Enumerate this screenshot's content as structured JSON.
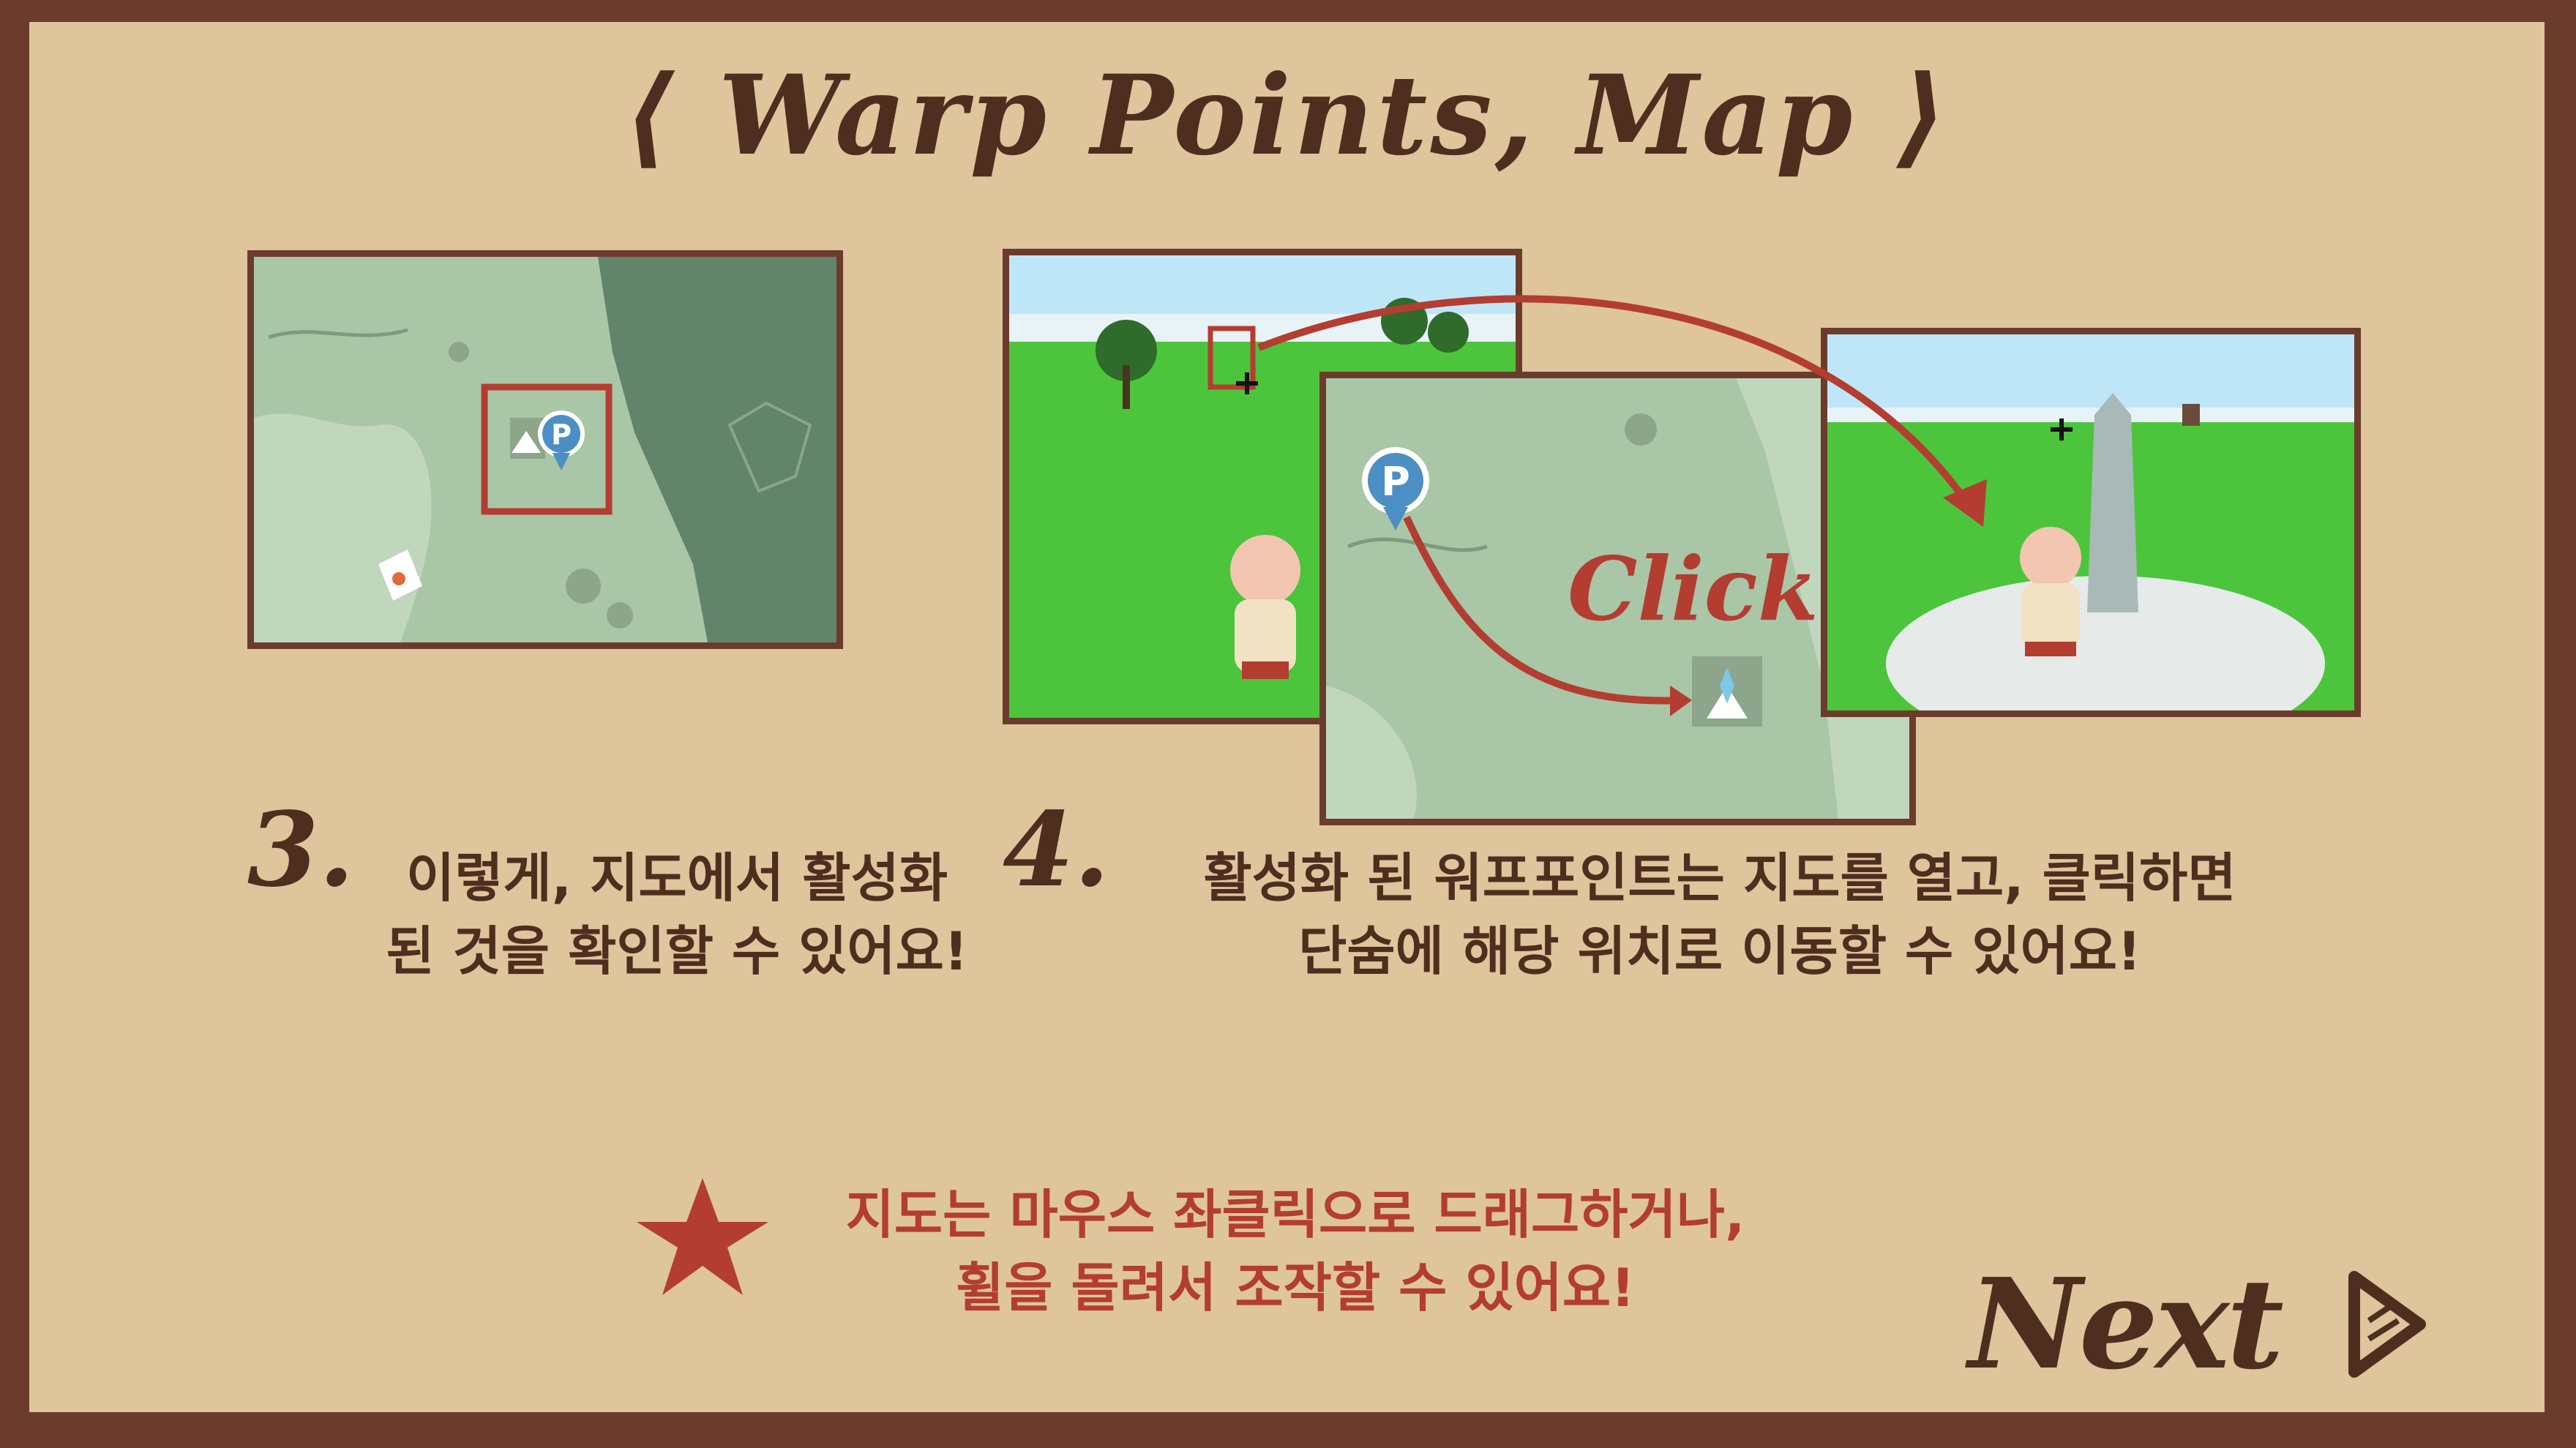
{
  "title": "⟨ Warp Points, Map ⟩",
  "step3": {
    "number": "3.",
    "line1": "이렇게, 지도에서 활성화",
    "line2": "된 것을 확인할 수 있어요!"
  },
  "step4": {
    "number": "4.",
    "line1": "활성화 된 워프포인트는 지도를 열고, 클릭하면",
    "line2": "단숨에 해당 위치로 이동할 수 있어요!"
  },
  "click_annotation": "Click!",
  "map_marker_letter": "P",
  "tip": {
    "line1": "지도는 마우스 좌클릭으로 드래그하거나,",
    "line2": "휠을 돌려서 조작할 수 있어요!"
  },
  "next_label": "Next",
  "colors": {
    "frame": "#6b3c2b",
    "paper": "#dec59b",
    "ink": "#4f2e1f",
    "accent_red": "#b43d32",
    "map_light": "#a9c7a6",
    "map_dark": "#62846a",
    "grass": "#4cc43b",
    "sky": "#bfe6f7"
  },
  "icons": [
    "warp-marker-icon",
    "campfire-icon",
    "star-icon",
    "play-arrow-icon",
    "crosshair-icon"
  ]
}
